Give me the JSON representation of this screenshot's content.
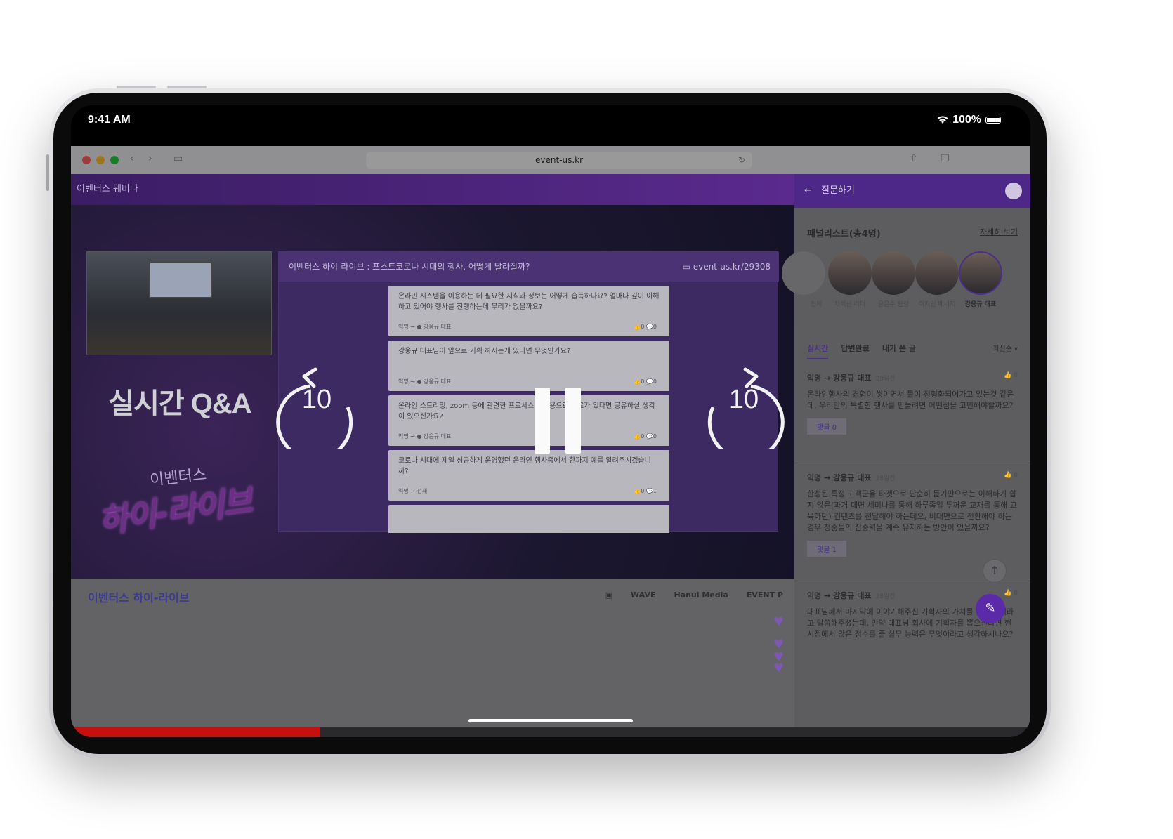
{
  "status": {
    "time": "9:41 AM",
    "battery": "100%"
  },
  "browser": {
    "url": "event-us.kr"
  },
  "page": {
    "header_title": "이벤터스 웨비나"
  },
  "video": {
    "slide_title": "이벤터스 하이-라이브 : 포스트코로나 시대의 행사, 어떻게 달라질까?",
    "slide_url": "event-us.kr/29308",
    "qa_title": "실시간 Q&A",
    "brand_small": "이벤터스",
    "brand_big": "하이-라이브",
    "questions": [
      {
        "text": "온라인 시스템을 이용하는 데 필요한 지식과 정보는 어떻게 습득하나요? 얼마나 깊이 이해하고 있어야 행사를 진행하는데 무리가 없을까요?",
        "meta": "익명 → ● 강웅규 대표",
        "stats": "👍0  💬0"
      },
      {
        "text": "강웅규 대표님이 앞으로 기획 하시는게 있다면 무엇인가요?",
        "meta": "익명 → ● 강웅규 대표",
        "stats": "👍0  💬0"
      },
      {
        "text": "온라인 스트리밍, zoom 등에 관련한 프로세스를 내용으로 자료가 있다면 공유하실 생각이 있으신가요?",
        "meta": "익명 → ● 강웅규 대표",
        "stats": "👍0  💬0"
      },
      {
        "text": "코로나 시대에 제일 성공하게 운영했던 온라인 행사중에서 한까지 예를 알려주시겠습니까?",
        "meta": "익명 → 전체",
        "stats": "👍0  💬1"
      }
    ],
    "rewind_label": "10",
    "forward_label": "10",
    "progress_fraction": 0.26
  },
  "footer": {
    "logo": "이벤터스 하이-라이브",
    "sponsors": [
      "▣",
      "WAVE",
      "Hanul Media",
      "EVENT P"
    ]
  },
  "side": {
    "title": "질문하기",
    "panelists_title": "패널리스트(총4명)",
    "panelists_more": "자세히 보기",
    "panelists": [
      {
        "name": "전체"
      },
      {
        "name": "차혜선 리더"
      },
      {
        "name": "윤은주 팀장"
      },
      {
        "name": "이지인 매니저"
      },
      {
        "name": "강웅규 대표"
      }
    ],
    "tabs": [
      "실시간",
      "답변완료",
      "내가 쓴 글"
    ],
    "sort": "최신순 ▾",
    "posts": [
      {
        "from": "익명",
        "to": "강웅규 대표",
        "ago": "28일전",
        "likes": "0",
        "body": "온라인행사의 경험이 쌓이면서 틀이 정형화되어가고 있는것 같은데, 우리만의 특별한 행사를 만들려면 어떤점을 고민해야할까요?",
        "reply": "댓글 0"
      },
      {
        "from": "익명",
        "to": "강웅규 대표",
        "ago": "28일전",
        "likes": "0",
        "body": "한정된 특정 고객군을 타겟으로 단순히 듣기만으로는 이해하기 쉽지 않은(과거 대면 세미나를 통해 하루종일 두꺼운 교재를 통해 교육하던) 컨텐츠를 전달해야 하는데요, 비대면으로 전환해야 하는 경우 청중들의 집중력을 계속 유지하는 방안이 있을까요?",
        "reply": "댓글 1"
      },
      {
        "from": "익명",
        "to": "강웅규 대표",
        "ago": "28일전",
        "likes": "0",
        "body": "대표님께서 마지막에 이야기해주신 기획자의 가치를 높일 기획라고 말씀해주셨는데, 만약 대표님 회사에 기획자를 뽑으신다면 현 시점에서 많은 점수를 줄 실무 능력은 무엇이라고 생각하시나요?",
        "reply": ""
      }
    ]
  }
}
